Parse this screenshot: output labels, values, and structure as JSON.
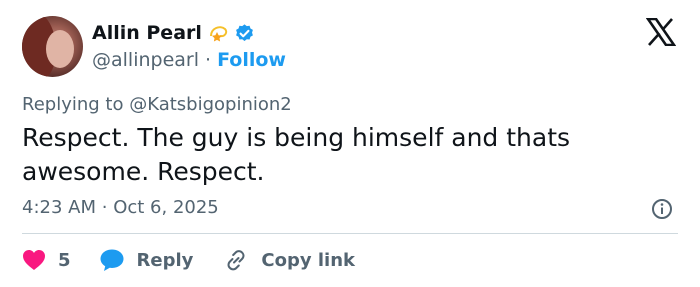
{
  "author": {
    "name": "Allin Pearl",
    "handle": "@allinpearl",
    "separator": "·",
    "follow_label": "Follow",
    "accent_color": "#1d9bf0"
  },
  "platform_icon": "x-logo-icon",
  "reply_context": {
    "prefix": "Replying to",
    "mention": "@Katsbigopinion2"
  },
  "tweet": {
    "text": "Respect. The guy is being himself and thats awesome. Respect."
  },
  "meta": {
    "time": "4:23 AM",
    "separator": "·",
    "date": "Oct 6, 2025"
  },
  "actions": {
    "likes_count": "5",
    "reply_label": "Reply",
    "copy_link_label": "Copy link",
    "like_color": "#f91880"
  }
}
